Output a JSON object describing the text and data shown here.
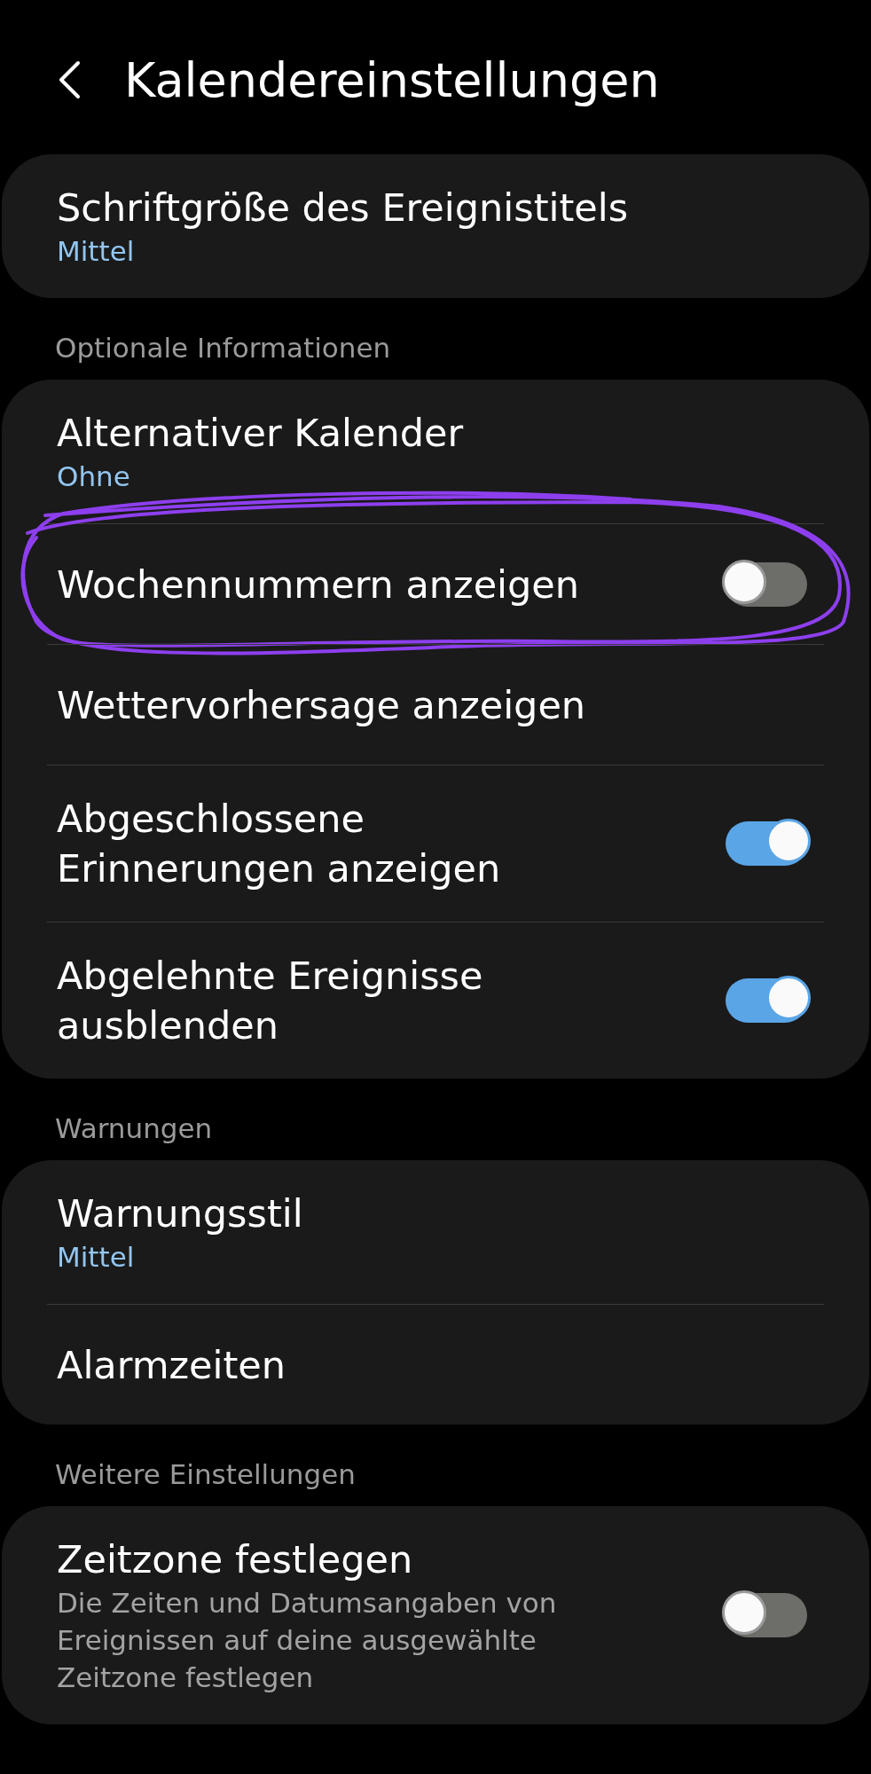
{
  "header": {
    "title": "Kalendereinstellungen"
  },
  "cards": [
    {
      "items": [
        {
          "kind": "value",
          "title": "Schriftgröße des Ereignistitels",
          "value": "Mittel",
          "circled": false
        }
      ]
    },
    {
      "heading": "Optionale Informationen",
      "items": [
        {
          "kind": "value",
          "title": "Alternativer Kalender",
          "value": "Ohne",
          "circled": false
        },
        {
          "kind": "switch",
          "title": "Wochennummern anzeigen",
          "on": false,
          "circled": true
        },
        {
          "kind": "plain",
          "title": "Wettervorhersage anzeigen",
          "circled": false
        },
        {
          "kind": "switch",
          "title": "Abgeschlossene Erinnerungen anzeigen",
          "on": true,
          "circled": false
        },
        {
          "kind": "switch",
          "title": "Abgelehnte Ereignisse ausblenden",
          "on": true,
          "circled": false
        }
      ]
    },
    {
      "heading": "Warnungen",
      "items": [
        {
          "kind": "value",
          "title": "Warnungsstil",
          "value": "Mittel",
          "circled": false
        },
        {
          "kind": "plain",
          "title": "Alarmzeiten",
          "circled": false
        }
      ]
    },
    {
      "heading": "Weitere Einstellungen",
      "items": [
        {
          "kind": "switch",
          "title": "Zeitzone festlegen",
          "description": "Die Zeiten und Datumsangaben von Ereignissen auf deine ausgewählte Zeitzone festlegen",
          "on": false,
          "circled": false
        }
      ]
    }
  ]
}
